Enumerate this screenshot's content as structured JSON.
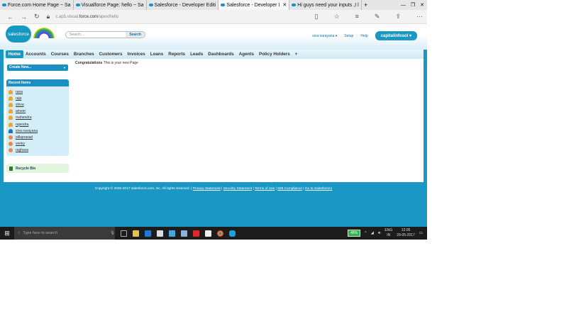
{
  "browser": {
    "tabs": [
      {
        "label": "Force.com Home Page ~ Sa"
      },
      {
        "label": "Visualforce Page: hello ~ Sa"
      },
      {
        "label": "Salesforce - Developer Editi"
      },
      {
        "label": "Salesforce - Developer I",
        "active": true
      },
      {
        "label": "Hi guys need your inputs ,I l"
      }
    ],
    "url_prefix": "c.ap5.visual.",
    "url_domain": "force.com",
    "url_path": "/apex/hello"
  },
  "header": {
    "logo": "salesforce",
    "search_placeholder": "Search...",
    "search_button": "Search",
    "user": "siva narayana ▾",
    "setup": "Setup",
    "help": "Help",
    "org": "capitalinfosol ▾"
  },
  "nav": {
    "tabs": [
      "Home",
      "Accounts",
      "Courses",
      "Branches",
      "Customers",
      "Invoices",
      "Loans",
      "Reports",
      "Leads",
      "Dashboards",
      "Agents",
      "Policy Holders",
      "+"
    ]
  },
  "sidebar": {
    "create_new": "Create New...",
    "recent_title": "Recent Items",
    "recent": [
      {
        "name": "rana",
        "type": "contact"
      },
      {
        "name": "raja",
        "type": "contact"
      },
      {
        "name": "shiva",
        "type": "contact"
      },
      {
        "name": "ameer",
        "type": "contact"
      },
      {
        "name": "mahendra",
        "type": "contact"
      },
      {
        "name": "rajendra",
        "type": "contact"
      },
      {
        "name": "siva narayana",
        "type": "user"
      },
      {
        "name": "pillaprasad",
        "type": "account"
      },
      {
        "name": "venky",
        "type": "account"
      },
      {
        "name": "raghava",
        "type": "account"
      }
    ],
    "recycle_bin": "Recycle Bin"
  },
  "main": {
    "bold": "Congratulations",
    "text": " This is your new Page"
  },
  "footer": {
    "copyright": "Copyright © 2000-2017 salesforce.com, inc. All rights reserved. | ",
    "links": [
      "Privacy Statement",
      "Security Statement",
      "Terms of Use",
      "508 Compliance",
      "Go to Salesforce1"
    ]
  },
  "taskbar": {
    "search": "Type here to search",
    "battery": "48%",
    "lang1": "ENG",
    "lang2": "IN",
    "time": "12:05",
    "date": "29-05-2017"
  }
}
